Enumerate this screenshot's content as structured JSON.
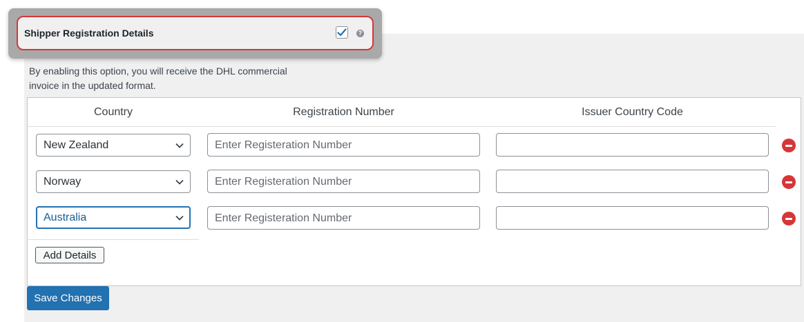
{
  "setting": {
    "title": "Shipper Registration Details",
    "checked": true,
    "help_icon": "?",
    "description": "By enabling this option, you will receive the DHL commercial invoice in the updated format."
  },
  "table": {
    "headers": {
      "country": "Country",
      "registration_number": "Registration Number",
      "issuer_country_code": "Issuer Country Code"
    },
    "rows": [
      {
        "country": "New Zealand",
        "registration_placeholder": "Enter Registeration Number",
        "issuer_country_code": ""
      },
      {
        "country": "Norway",
        "registration_placeholder": "Enter Registeration Number",
        "issuer_country_code": ""
      },
      {
        "country": "Australia",
        "registration_placeholder": "Enter Registeration Number",
        "issuer_country_code": ""
      }
    ],
    "add_label": "Add Details"
  },
  "actions": {
    "save_label": "Save Changes"
  },
  "colors": {
    "primary": "#2271b1",
    "danger": "#d63638",
    "panel_bg": "#f0f0f1"
  },
  "icons": {
    "checkbox": "check-icon",
    "help": "help-icon",
    "remove": "remove-row-icon",
    "dropdown": "chevron-down-icon"
  }
}
